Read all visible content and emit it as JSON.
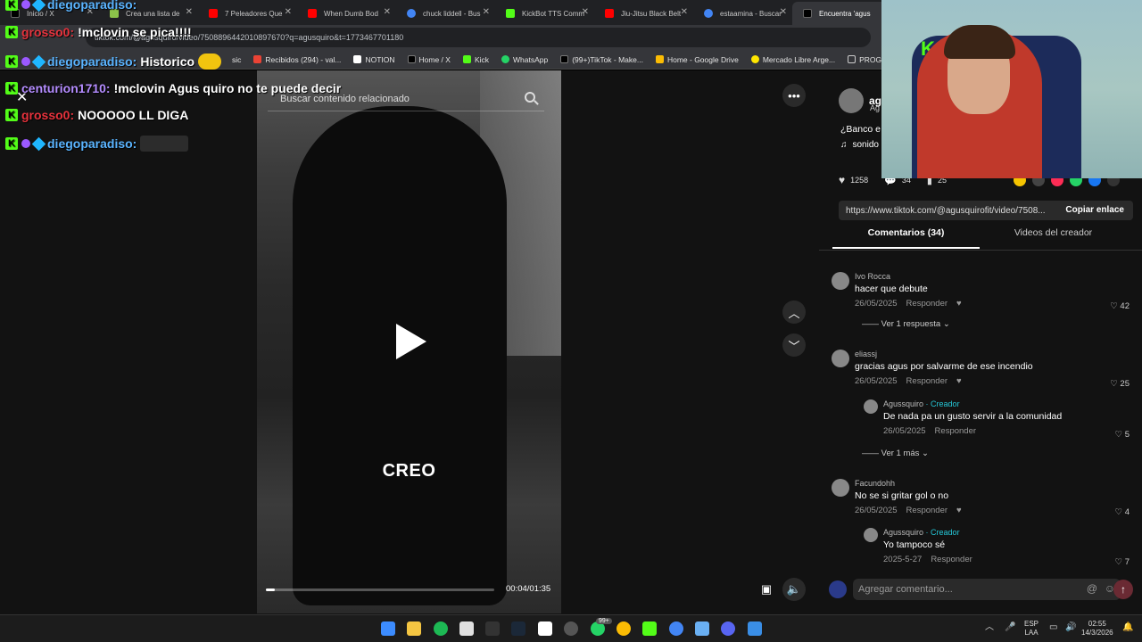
{
  "tabs": [
    {
      "label": "Inicio / X",
      "color": "#000000"
    },
    {
      "label": "Crea una lista de",
      "color": "#8bc34a"
    },
    {
      "label": "7 Peleadores Que",
      "color": "#ff0000"
    },
    {
      "label": "When Dumb Bod",
      "color": "#ff0000"
    },
    {
      "label": "chuck liddell - Bus",
      "color": "#4285f4"
    },
    {
      "label": "KickBot TTS Comm",
      "color": "#53fc18"
    },
    {
      "label": "Jiu-Jitsu Black Belt",
      "color": "#ff0000"
    },
    {
      "label": "estaamina - Buscar",
      "color": "#4285f4"
    },
    {
      "label": "Encuentra 'agus",
      "color": "#000000"
    }
  ],
  "address": {
    "url": "tiktok.com/@agusquiro/video/7508896442010897670?q=agusquiro&t=1773467701180"
  },
  "bookmarks": [
    {
      "label": "sic",
      "color": "#888888"
    },
    {
      "label": "Recibidos (294) - val...",
      "color": "#ea4335"
    },
    {
      "label": "NOTION",
      "color": "#ffffff"
    },
    {
      "label": "Home / X",
      "color": "#000000"
    },
    {
      "label": "Kick",
      "color": "#53fc18"
    },
    {
      "label": "WhatsApp",
      "color": "#25d366"
    },
    {
      "label": "(99+)TikTok - Make...",
      "color": "#000000"
    },
    {
      "label": "Home - Google Drive",
      "color": "#fbbc04"
    },
    {
      "label": "Mercado Libre Arge...",
      "color": "#ffe600"
    },
    {
      "label": "PROG",
      "color": "#888888"
    }
  ],
  "chat": [
    {
      "user": "diegoparadiso:",
      "message": "",
      "user_color": "#5ab4ff"
    },
    {
      "user": "grosso0:",
      "message": "!mclovin se pica!!!!",
      "user_color": "#e6323c"
    },
    {
      "user": "diegoparadiso:",
      "message": "Historico",
      "user_color": "#5ab4ff"
    },
    {
      "user": "centurion1710:",
      "message": "!mclovin Agus quiro no te puede decir",
      "user_color": "#b48cff"
    },
    {
      "user": "grosso0:",
      "message": "NOOOOO LL DIGA",
      "user_color": "#e6323c"
    },
    {
      "user": "diegoparadiso:",
      "message": "",
      "user_color": "#5ab4ff"
    }
  ],
  "video": {
    "search_placeholder": "Buscar contenido relacionado",
    "caption": "CREO",
    "time": "00:04/01:35",
    "progress_fraction": 0.04
  },
  "panel": {
    "author_short": "ag",
    "author_sub": "Ag",
    "desc": "¿Banco e",
    "sound": "sonido",
    "likes": "1258",
    "comments_count": "34",
    "saves": "25",
    "link": "https://www.tiktok.com/@agusquirofit/video/7508...",
    "copy_label": "Copiar enlace",
    "tab_comments": "Comentarios (34)",
    "tab_videos": "Videos del creador",
    "reply_label": "Responder",
    "input_placeholder": "Agregar comentario...",
    "comments": [
      {
        "user": "Ivo Rocca",
        "text": "hacer que debute",
        "date": "26/05/2025",
        "likes": "42",
        "expand": "Ver 1 respuesta"
      },
      {
        "user": "eliassj",
        "text": "gracias agus por salvarme de ese incendio",
        "date": "26/05/2025",
        "likes": "25",
        "reply": {
          "user": "Agussquiro",
          "tag": "· Creador",
          "text": "De nada pa un gusto servir a la comunidad",
          "date": "26/05/2025",
          "likes": "5"
        },
        "expand": "Ver 1 más"
      },
      {
        "user": "Facundohh",
        "text": "No se si gritar gol o no",
        "date": "26/05/2025",
        "likes": "4",
        "reply": {
          "user": "Agussquiro",
          "tag": "· Creador",
          "text": "Yo tampoco sé",
          "date": "2025-5-27",
          "likes": "7"
        }
      }
    ]
  },
  "taskbar": {
    "lang": "ESP",
    "lang2": "LAA",
    "time": "02:55",
    "date": "14/3/2026",
    "badge": "99+"
  }
}
